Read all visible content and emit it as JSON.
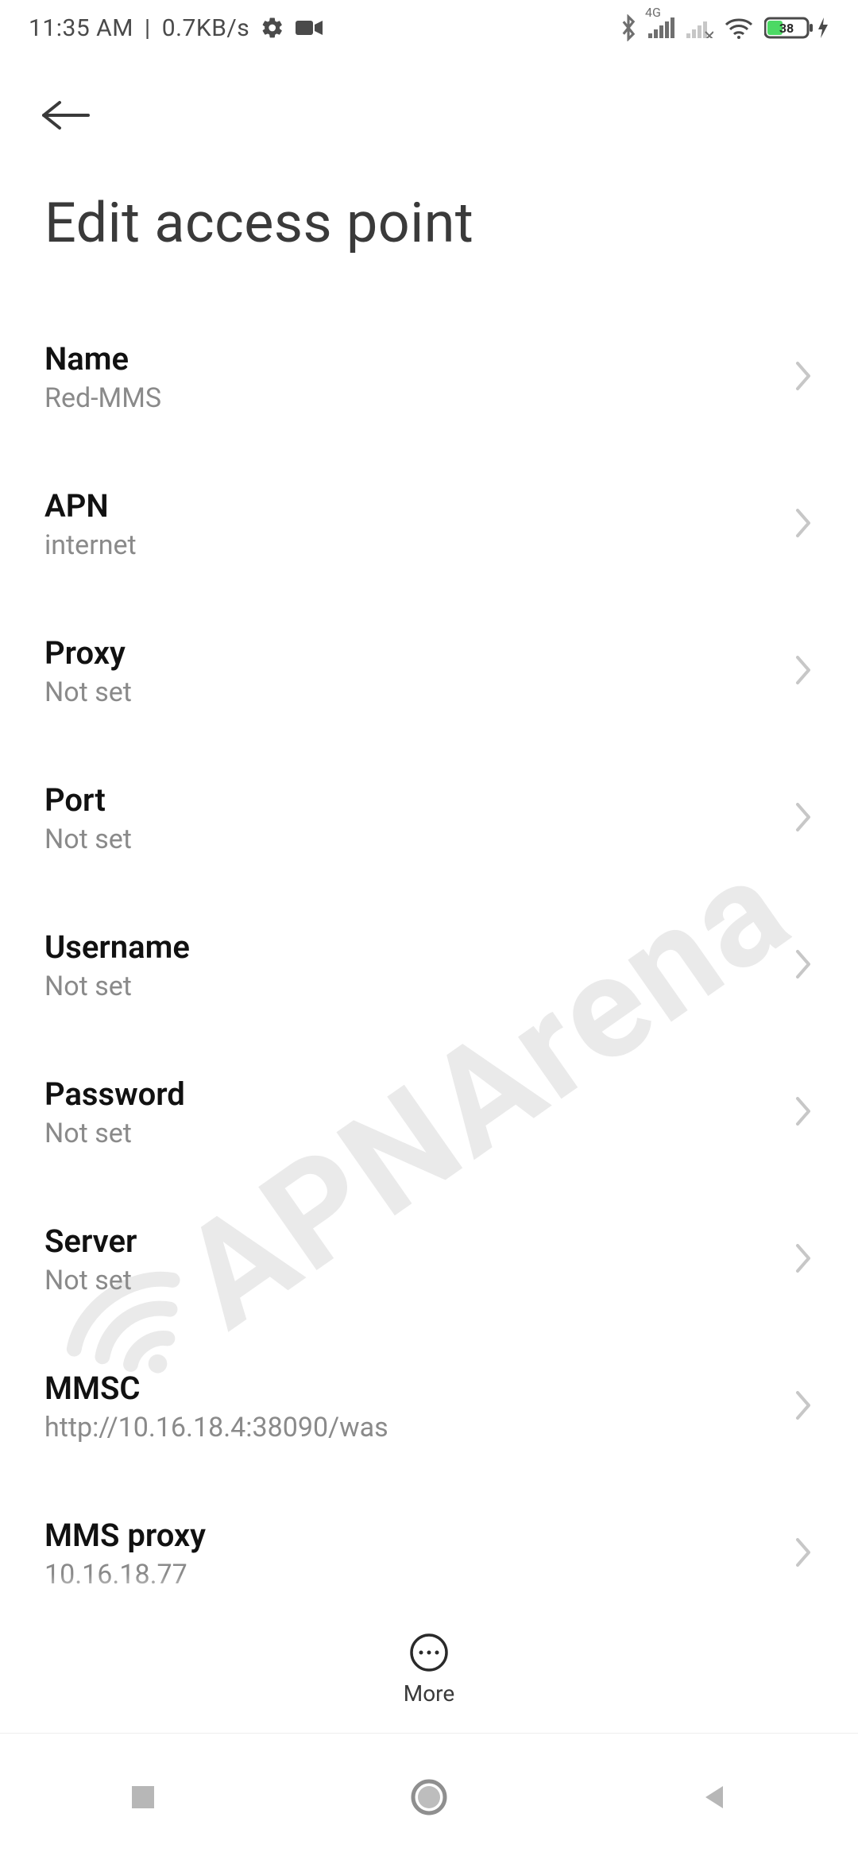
{
  "status": {
    "time": "11:35 AM",
    "sep": "|",
    "net_speed": "0.7KB/s",
    "signal_label": "4G",
    "battery_pct": "38"
  },
  "header": {},
  "page": {
    "title": "Edit access point"
  },
  "rows": [
    {
      "label": "Name",
      "value": "Red-MMS"
    },
    {
      "label": "APN",
      "value": "internet"
    },
    {
      "label": "Proxy",
      "value": "Not set"
    },
    {
      "label": "Port",
      "value": "Not set"
    },
    {
      "label": "Username",
      "value": "Not set"
    },
    {
      "label": "Password",
      "value": "Not set"
    },
    {
      "label": "Server",
      "value": "Not set"
    },
    {
      "label": "MMSC",
      "value": "http://10.16.18.4:38090/was"
    },
    {
      "label": "MMS proxy",
      "value": "10.16.18.77"
    }
  ],
  "toolbar": {
    "more_label": "More"
  },
  "watermark": {
    "text": "APNArena"
  }
}
